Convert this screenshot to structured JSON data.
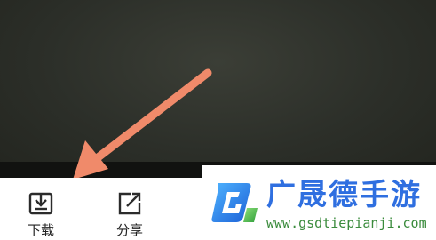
{
  "toolbar": {
    "download_label": "下载",
    "share_label": "分享"
  },
  "watermark": {
    "name": "广晟德手游",
    "url": "www.gsdtiepianji.com"
  },
  "icons": {
    "download": "download-icon",
    "share": "share-icon"
  },
  "colors": {
    "arrow": "#f08a6a",
    "watermark_blue": "#2f6fe0",
    "watermark_green": "#3a8b3c"
  }
}
